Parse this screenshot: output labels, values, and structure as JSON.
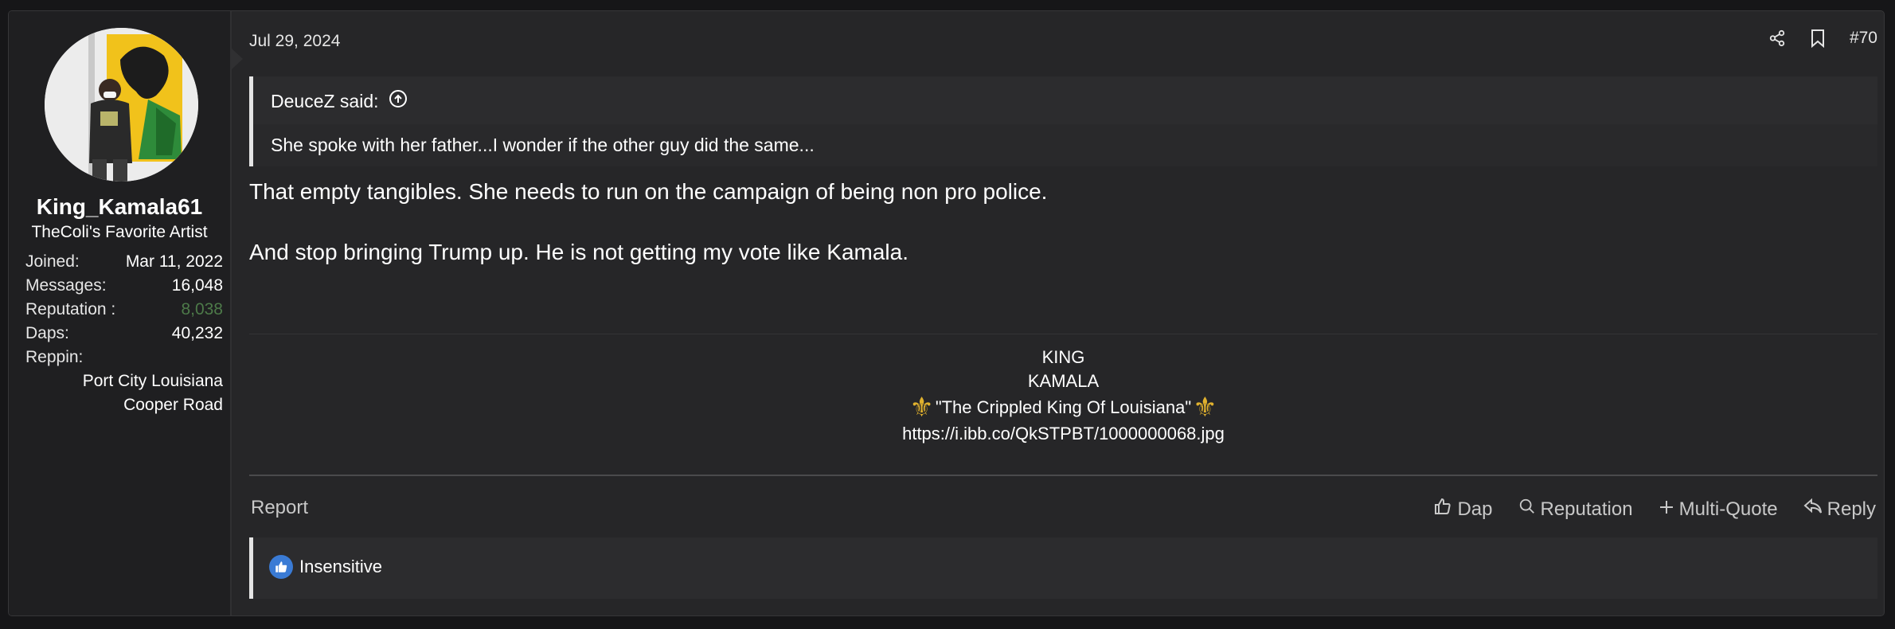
{
  "user": {
    "name": "King_Kamala61",
    "title": "TheColi's Favorite Artist",
    "stats": [
      {
        "key": "Joined:",
        "value": "Mar 11, 2022"
      },
      {
        "key": "Messages:",
        "value": "16,048"
      },
      {
        "key": "Reputation :",
        "value": "8,038"
      },
      {
        "key": "Daps:",
        "value": "40,232"
      }
    ],
    "reppin_key": "Reppin:",
    "reppin_value": "Port City Louisiana\nCooper Road"
  },
  "post": {
    "date": "Jul 29, 2024",
    "number": "#70",
    "quote": {
      "author": "DeuceZ said:",
      "text": "She spoke with her father...I wonder if the other guy did the same..."
    },
    "message": [
      "That empty tangibles. She needs to run on the campaign of being non pro police.",
      "And stop bringing Trump up. He is not getting my vote like Kamala."
    ],
    "signature": {
      "line1": "KING",
      "line2": "KAMALA",
      "quote_text": "\"The Crippled King Of Louisiana\"",
      "fleur_glyph": "⚜",
      "url": "https://i.ibb.co/QkSTPBT/1000000068.jpg"
    }
  },
  "footer": {
    "report": "Report",
    "actions": [
      {
        "label": "Dap",
        "icon": "thumbs-up-icon"
      },
      {
        "label": "Reputation",
        "icon": "search-icon"
      },
      {
        "label": "Multi-Quote",
        "icon": "plus-icon"
      },
      {
        "label": "Reply",
        "icon": "reply-icon"
      }
    ]
  },
  "reactions": {
    "label": "Insensitive",
    "icon": "like-icon"
  },
  "colors": {
    "background": "#161618",
    "post_bg": "#262628",
    "sidebar_bg": "#1f1f21",
    "reputation_green": "#4d7a49",
    "fleur_gold": "#e0b12e",
    "like_blue": "#3a7bd5"
  }
}
